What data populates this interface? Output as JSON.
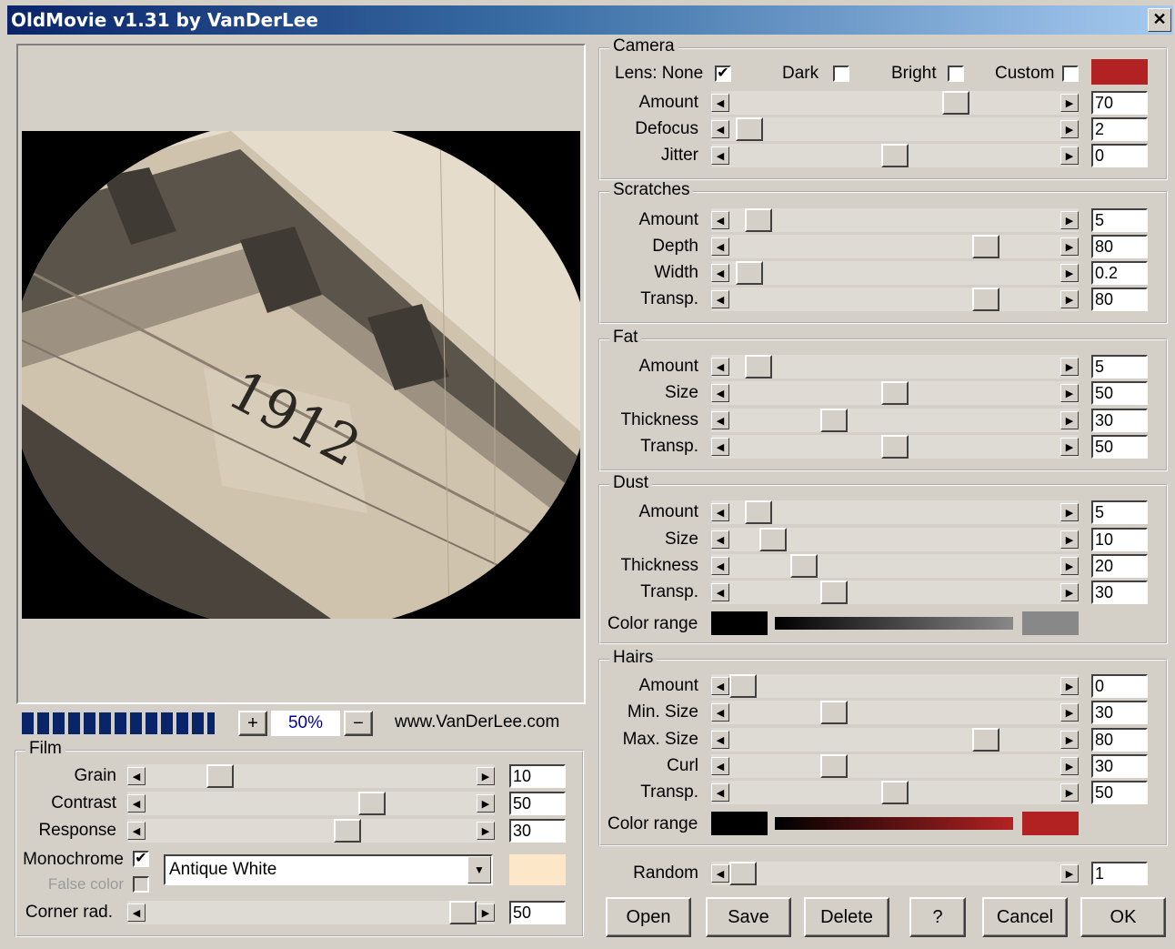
{
  "window": {
    "title": "OldMovie v1.31 by VanDerLee",
    "close_label": "✕"
  },
  "preview": {
    "photo_text": "1912",
    "zoom": "50%",
    "zoom_plus": "+",
    "zoom_minus": "−",
    "website": "www.VanDerLee.com",
    "progress": 1.0
  },
  "colors": {
    "camera_custom": "#b32222",
    "film_tint": "#fde7c9",
    "dust_range_start": "#000000",
    "dust_range_end": "#888888",
    "hairs_range_start": "#000000",
    "hairs_range_end": "#b32222",
    "title_bar": "#0a246a"
  },
  "arrows": {
    "left": "◀",
    "right": "▶",
    "dropdown": "▼",
    "check": "✔"
  },
  "camera": {
    "title": "Camera",
    "lens_label": "Lens: None",
    "lens_none": true,
    "dark_label": "Dark",
    "dark": false,
    "bright_label": "Bright",
    "bright": false,
    "custom_label": "Custom",
    "custom": false,
    "sliders": [
      {
        "label": "Amount",
        "value": "70",
        "pos": 0.7
      },
      {
        "label": "Defocus",
        "value": "2",
        "pos": 0.02
      },
      {
        "label": "Jitter",
        "value": "0",
        "pos": 0.5
      }
    ]
  },
  "scratches": {
    "title": "Scratches",
    "sliders": [
      {
        "label": "Amount",
        "value": "5",
        "pos": 0.05
      },
      {
        "label": "Depth",
        "value": "80",
        "pos": 0.8
      },
      {
        "label": "Width",
        "value": "0.2",
        "pos": 0.02
      },
      {
        "label": "Transp.",
        "value": "80",
        "pos": 0.8
      }
    ]
  },
  "fat": {
    "title": "Fat",
    "sliders": [
      {
        "label": "Amount",
        "value": "5",
        "pos": 0.05
      },
      {
        "label": "Size",
        "value": "50",
        "pos": 0.5
      },
      {
        "label": "Thickness",
        "value": "30",
        "pos": 0.3
      },
      {
        "label": "Transp.",
        "value": "50",
        "pos": 0.5
      }
    ]
  },
  "dust": {
    "title": "Dust",
    "sliders": [
      {
        "label": "Amount",
        "value": "5",
        "pos": 0.05
      },
      {
        "label": "Size",
        "value": "10",
        "pos": 0.1
      },
      {
        "label": "Thickness",
        "value": "20",
        "pos": 0.2
      },
      {
        "label": "Transp.",
        "value": "30",
        "pos": 0.3
      }
    ],
    "color_range_label": "Color range"
  },
  "hairs": {
    "title": "Hairs",
    "sliders": [
      {
        "label": "Amount",
        "value": "0",
        "pos": 0.0
      },
      {
        "label": "Min. Size",
        "value": "30",
        "pos": 0.3
      },
      {
        "label": "Max. Size",
        "value": "80",
        "pos": 0.8
      },
      {
        "label": "Curl",
        "value": "30",
        "pos": 0.3
      },
      {
        "label": "Transp.",
        "value": "50",
        "pos": 0.5
      }
    ],
    "color_range_label": "Color range"
  },
  "random": {
    "label": "Random",
    "value": "1",
    "pos": 0.0
  },
  "film": {
    "title": "Film",
    "sliders": [
      {
        "label": "Grain",
        "value": "10",
        "pos": 0.2
      },
      {
        "label": "Contrast",
        "value": "50",
        "pos": 0.7
      },
      {
        "label": "Response",
        "value": "30",
        "pos": 0.62
      }
    ],
    "monochrome_label": "Monochrome",
    "monochrome": true,
    "false_color_label": "False color",
    "false_color": false,
    "tint_name": "Antique White",
    "corner_label": "Corner rad.",
    "corner_value": "50",
    "corner_pos": 1.0
  },
  "buttons": {
    "open": "Open",
    "save": "Save",
    "delete": "Delete",
    "help": "?",
    "cancel": "Cancel",
    "ok": "OK"
  }
}
